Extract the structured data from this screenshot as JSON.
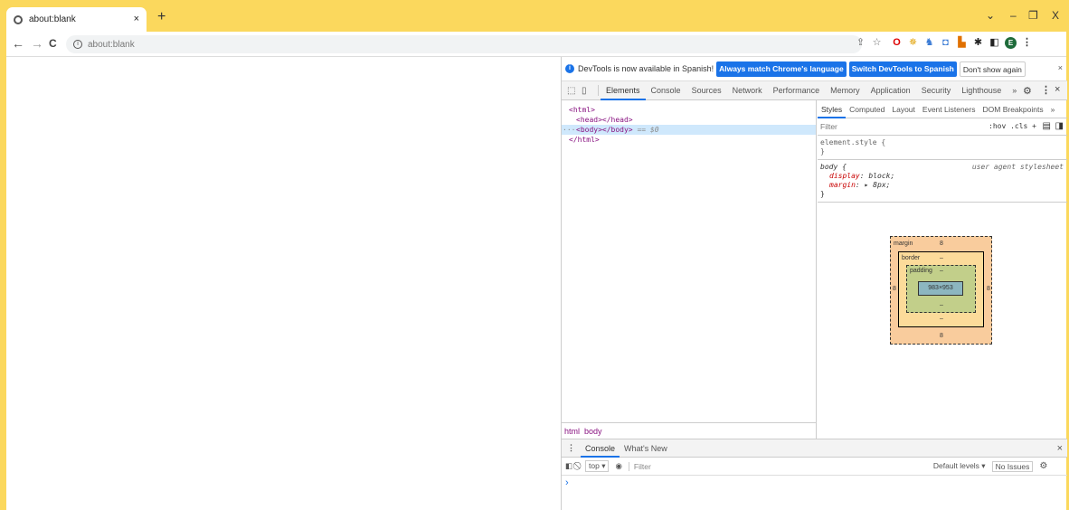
{
  "browser": {
    "tab": {
      "title": "about:blank",
      "close": "×"
    },
    "new_tab": "+",
    "window_controls": {
      "dropdown": "⌄",
      "minimize": "–",
      "restore": "❐",
      "close": "X"
    },
    "nav": {
      "back": "←",
      "forward": "→",
      "reload": "C"
    },
    "omnibox": {
      "url": "about:blank"
    },
    "profile_letter": "E"
  },
  "devtools": {
    "infobar": {
      "message": "DevTools is now available in Spanish!",
      "btn_match": "Always match Chrome's language",
      "btn_switch": "Switch DevTools to Spanish",
      "btn_dismiss": "Don't show again",
      "close": "×"
    },
    "tabs": [
      "Elements",
      "Console",
      "Sources",
      "Network",
      "Performance",
      "Memory",
      "Application",
      "Security",
      "Lighthouse"
    ],
    "more_tabs": "»",
    "dom": {
      "l1": "<html>",
      "l2": "<head></head>",
      "l3": "<body></body>",
      "l3_suffix": "== $0",
      "l4": "</html>",
      "dots": "···"
    },
    "breadcrumbs": [
      "html",
      "body"
    ],
    "styles_tabs": [
      "Styles",
      "Computed",
      "Layout",
      "Event Listeners",
      "DOM Breakpoints"
    ],
    "styles_more": "»",
    "filter_placeholder": "Filter",
    "hov_cls": ":hov  .cls  +",
    "element_style": {
      "selector": "element.style {",
      "close": "}"
    },
    "body_rule": {
      "selector": "body {",
      "source": "user agent stylesheet",
      "p1_name": "display",
      "p1_value": " block;",
      "p2_name": "margin",
      "p2_value": " ▸ 8px;",
      "close": "}"
    },
    "box_model": {
      "margin_label": "margin",
      "margin_top": "8",
      "margin_bottom": "8",
      "margin_left": "8",
      "margin_right": "8",
      "border_label": "border",
      "border_value": "–",
      "padding_label": "padding",
      "padding_value": "–",
      "content": "983×953"
    },
    "drawer": {
      "tabs": [
        "Console",
        "What's New"
      ],
      "close": "×",
      "context": "top ▾",
      "filter_placeholder": "Filter",
      "levels": "Default levels ▾",
      "issues": "No Issues",
      "prompt": "›"
    }
  }
}
